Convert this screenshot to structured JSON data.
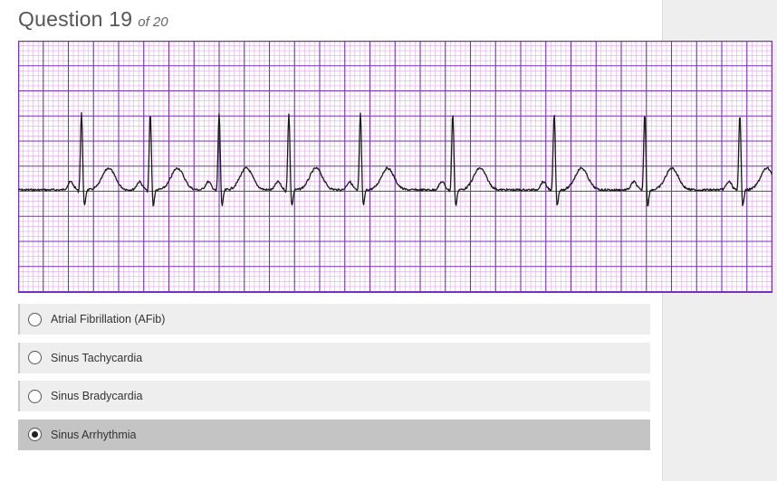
{
  "question": {
    "label": "Question 19",
    "of_text": "of 20"
  },
  "ecg": {
    "grid_major_color": "#7b2fbe",
    "grid_minor_color": "#e3a7ee",
    "background": "#ffffff",
    "trace_color": "#1a1a1a"
  },
  "options": [
    {
      "label": "Atrial Fibrillation (AFib)",
      "selected": false
    },
    {
      "label": "Sinus Tachycardia",
      "selected": false
    },
    {
      "label": "Sinus Bradycardia",
      "selected": false
    },
    {
      "label": "Sinus Arrhythmia",
      "selected": true
    }
  ]
}
